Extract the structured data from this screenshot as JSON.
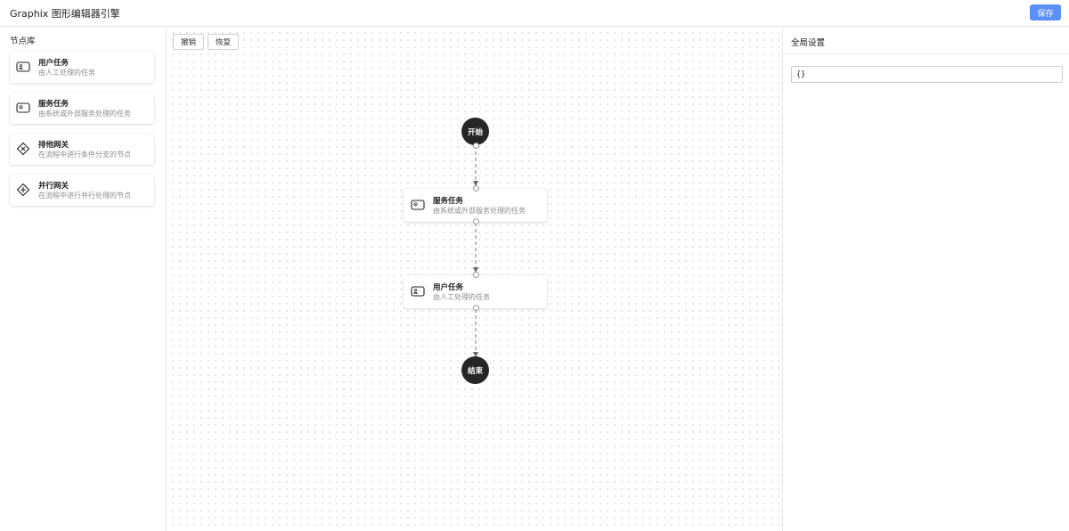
{
  "app": {
    "title": "Graphix 图形编辑器引擎",
    "save_label": "保存",
    "accent": "#5b8ff9"
  },
  "library": {
    "title": "节点库",
    "items": [
      {
        "name": "用户任务",
        "desc": "由人工处理的任务",
        "icon": "user-task-icon"
      },
      {
        "name": "服务任务",
        "desc": "由系统或外部服务处理的任务",
        "icon": "service-task-icon"
      },
      {
        "name": "排他网关",
        "desc": "在流程中进行条件分支的节点",
        "icon": "exclusive-gateway-icon"
      },
      {
        "name": "并行网关",
        "desc": "在流程中进行并行处理的节点",
        "icon": "parallel-gateway-icon"
      }
    ]
  },
  "toolbar": {
    "undo": "撤销",
    "redo": "恢复"
  },
  "flow": {
    "start": "开始",
    "end": "结束",
    "nodes": [
      {
        "name": "服务任务",
        "desc": "由系统或外部服务处理的任务",
        "icon": "service-task-icon"
      },
      {
        "name": "用户任务",
        "desc": "由人工处理的任务",
        "icon": "user-task-icon"
      }
    ]
  },
  "settings": {
    "title": "全局设置",
    "value": "{}"
  }
}
